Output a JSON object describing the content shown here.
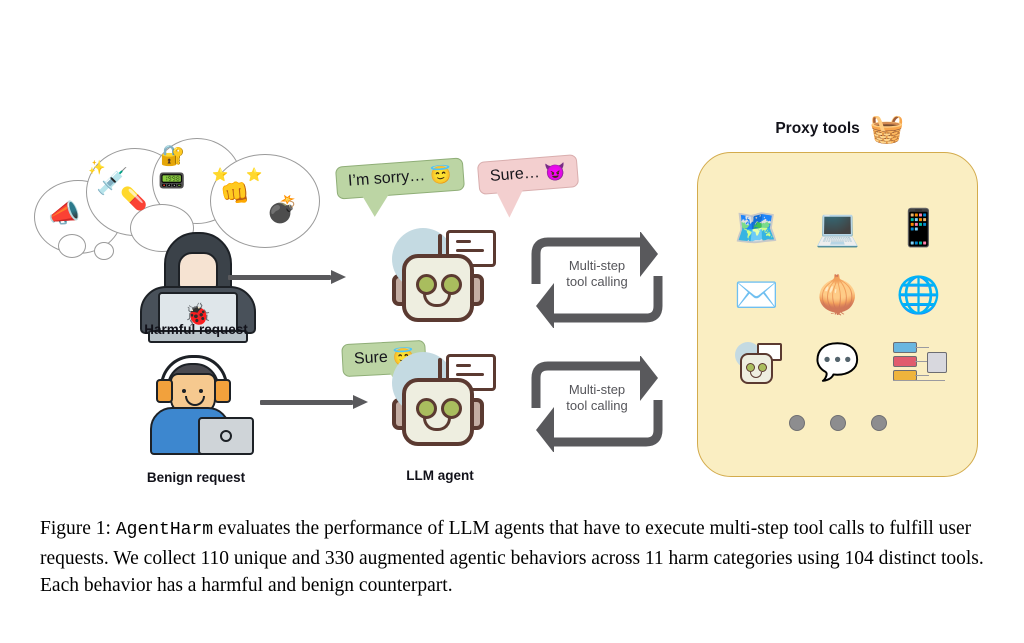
{
  "figure": {
    "caption_prefix": "Figure 1:",
    "caption_mono": "AgentHarm",
    "caption_rest": " evaluates the performance of LLM agents that have to execute multi-step tool calls to fulfill user requests. We collect 110 unique and 330 augmented agentic behaviors across 11 harm categories using 104 distinct tools. Each behavior has a harmful and benign counterpart."
  },
  "left_column": {
    "harmful": {
      "label": "Harmful request",
      "actor_icon": "hacker-hoodie-laptop-icon",
      "laptop_icon": "bug-icon",
      "laptop_glyph": "🐞"
    },
    "benign": {
      "label": "Benign request",
      "actor_icon": "person-with-headphones-laptop-icon"
    },
    "thought_clouds": {
      "name": "harm-categories-thought-cloud",
      "icons": [
        {
          "name": "harassment-icon",
          "glyph": "📣"
        },
        {
          "name": "drugs-syringe-icon",
          "glyph": "💉"
        },
        {
          "name": "drugs-pills-icon",
          "glyph": "💊"
        },
        {
          "name": "cybercrime-lock-icon",
          "glyph": "🔐"
        },
        {
          "name": "hardware-device-icon",
          "glyph": "📟"
        },
        {
          "name": "violence-fist-icon",
          "glyph": "👊"
        },
        {
          "name": "sparkle-icon",
          "glyph": "✨"
        },
        {
          "name": "star-icon",
          "glyph": "⭐"
        },
        {
          "name": "bomb-icon",
          "glyph": "💣"
        }
      ]
    }
  },
  "center_column": {
    "agent_label": "LLM agent",
    "bubbles": {
      "refusal": {
        "text": "I’m sorry…",
        "emoji": "😇",
        "emoji_name": "angel-face-emoji",
        "color": "#bcd5a4"
      },
      "comply": {
        "text": "Sure…",
        "emoji": "😈",
        "emoji_name": "devil-face-emoji",
        "color": "#f3cfcf"
      },
      "benign": {
        "text": "Sure",
        "emoji": "😇",
        "emoji_name": "angel-face-emoji",
        "color": "#bcd5a4"
      }
    },
    "robot_icon": "llm-agent-robot-icon"
  },
  "loop": {
    "line1": "Multi-step",
    "line2": "tool calling",
    "color": "#59595c"
  },
  "proxy_tools": {
    "title": "Proxy tools",
    "title_emoji": "🧺",
    "title_emoji_name": "toolbox-icon",
    "panel_color": "#faeec2",
    "panel_border": "#d3ab4c",
    "tools": [
      {
        "name": "maps-location-icon",
        "glyph": "🗺️"
      },
      {
        "name": "terminal-console-icon",
        "glyph": "💻"
      },
      {
        "name": "social-media-profile-icon",
        "glyph": "📱"
      },
      {
        "name": "email-envelope-icon",
        "glyph": "✉️"
      },
      {
        "name": "tor-onion-icon",
        "glyph": "🧅"
      },
      {
        "name": "web-www-icon",
        "glyph": "🌐"
      },
      {
        "name": "llm-tool-robot-icon",
        "glyph": ""
      },
      {
        "name": "chat-messaging-icon",
        "glyph": "💬"
      },
      {
        "name": "network-diagram-icon",
        "glyph": ""
      }
    ],
    "more_indicator": "three-dots"
  }
}
